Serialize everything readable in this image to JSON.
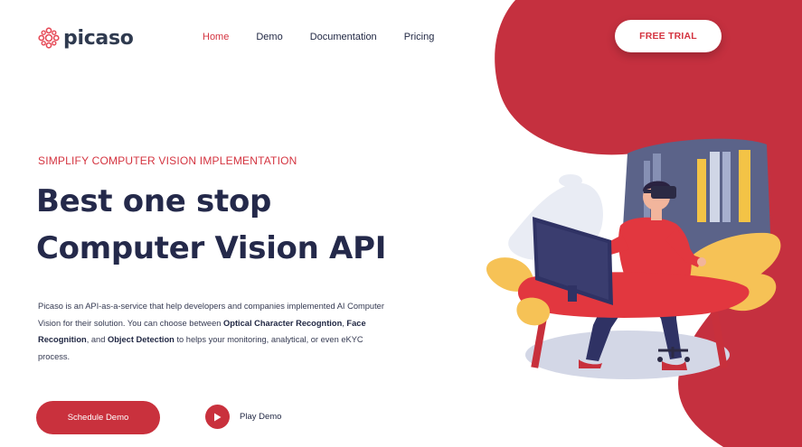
{
  "brand": {
    "name": "picaso",
    "accent": "#d43440",
    "dark": "#24294a"
  },
  "nav": {
    "items": [
      {
        "label": "Home",
        "active": true
      },
      {
        "label": "Demo",
        "active": false
      },
      {
        "label": "Documentation",
        "active": false
      },
      {
        "label": "Pricing",
        "active": false
      }
    ]
  },
  "header": {
    "cta_label": "FREE TRIAL"
  },
  "hero": {
    "eyebrow": "SIMPLIFY COMPUTER VISION IMPLEMENTATION",
    "headline_line1": "Best one stop",
    "headline_line2": "Computer Vision API",
    "description": {
      "t1": "Picaso is an API-as-a-service that help developers and companies implemented AI Computer Vision for their solution. You can choose between ",
      "b1": "Optical Character Recogntion",
      "t2": ", ",
      "b2": "Face Recognition",
      "t3": ", and ",
      "b3": "Object Detection",
      "t4": " to helps your monitoring, analytical, or even eKYC process."
    },
    "primary_cta": "Schedule Demo",
    "secondary_cta": "Play Demo"
  },
  "icons": {
    "logo": "flower-dots-logo-icon",
    "play": "play-icon",
    "illustration": "vr-user-at-desk-illustration"
  }
}
